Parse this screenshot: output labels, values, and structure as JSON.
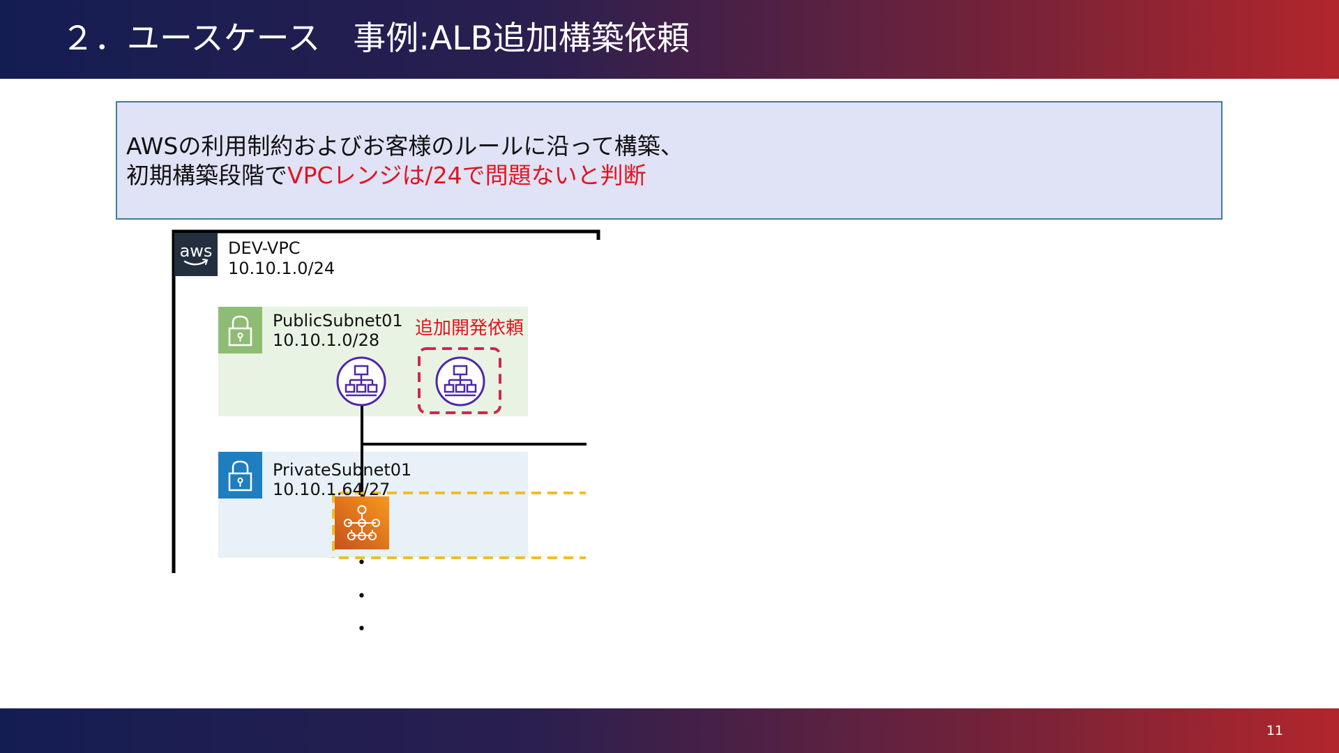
{
  "header": {
    "title": "２．ユースケース　事例:ALB追加構築依頼"
  },
  "callout": {
    "line1": "AWSの利用制約およびお客様のルールに沿って構築、",
    "line2_prefix": "初期構築段階で",
    "line2_highlight": "VPCレンジは/24で問題ないと判断"
  },
  "diagram": {
    "vpc": {
      "name": "DEV-VPC",
      "cidr": "10.10.1.0/24",
      "icon": "aws-logo-icon",
      "logo_text": "aws"
    },
    "public_subnet": {
      "name": "PublicSubnet01",
      "cidr": "10.10.1.0/28",
      "icon": "lock-icon"
    },
    "private_subnet": {
      "name": "PrivateSubnet01",
      "cidr": "10.10.1.64/27",
      "icon": "lock-icon"
    },
    "request_label": "追加開発依頼",
    "icons": [
      "alb-icon",
      "alb-request-icon",
      "ecs-icon"
    ],
    "continuation_dots": [
      "•",
      "•",
      "•"
    ],
    "colors": {
      "public_subnet_fill": "#e8f3e3",
      "public_subnet_icon": "#8fbc74",
      "private_subnet_fill": "#e7f1f7",
      "private_subnet_icon": "#1f7ebd",
      "alb": "#4d27aa",
      "request_border": "#d0245a",
      "ecs_border": "#f0be2c",
      "ecs_fill": "#e8731c"
    }
  },
  "footer": {
    "page_number": "11"
  }
}
